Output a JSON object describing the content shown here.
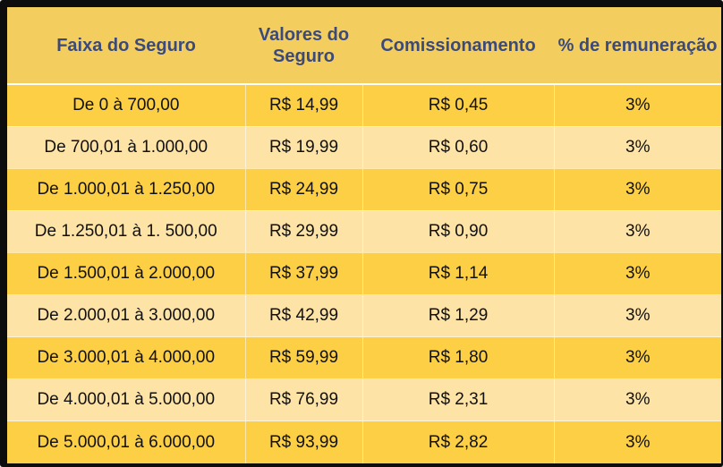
{
  "table": {
    "headers": [
      "Faixa do Seguro",
      "Valores do Seguro",
      "Comissionamento",
      "% de remuneração"
    ],
    "rows": [
      [
        "De 0 à 700,00",
        "R$ 14,99",
        "R$ 0,45",
        "3%"
      ],
      [
        "De 700,01 à 1.000,00",
        "R$ 19,99",
        "R$ 0,60",
        "3%"
      ],
      [
        "De 1.000,01 à 1.250,00",
        "R$ 24,99",
        "R$ 0,75",
        "3%"
      ],
      [
        "De 1.250,01 à 1. 500,00",
        "R$ 29,99",
        "R$ 0,90",
        "3%"
      ],
      [
        "De 1.500,01 à 2.000,00",
        "R$ 37,99",
        "R$ 1,14",
        "3%"
      ],
      [
        "De 2.000,01 à 3.000,00",
        "R$ 42,99",
        "R$ 1,29",
        "3%"
      ],
      [
        "De 3.000,01 à 4.000,00",
        "R$ 59,99",
        "R$ 1,80",
        "3%"
      ],
      [
        "De 4.000,01 à 5.000,00",
        "R$ 76,99",
        "R$ 2,31",
        "3%"
      ],
      [
        "De 5.000,01 à 6.000,00",
        "R$ 93,99",
        "R$ 2,82",
        "3%"
      ]
    ]
  },
  "colors": {
    "header_bg": "#f3cd5e",
    "header_text": "#3b4a7a",
    "row_odd": "#fccf45",
    "row_even": "#fde3a6",
    "frame": "#0d0d0d"
  }
}
